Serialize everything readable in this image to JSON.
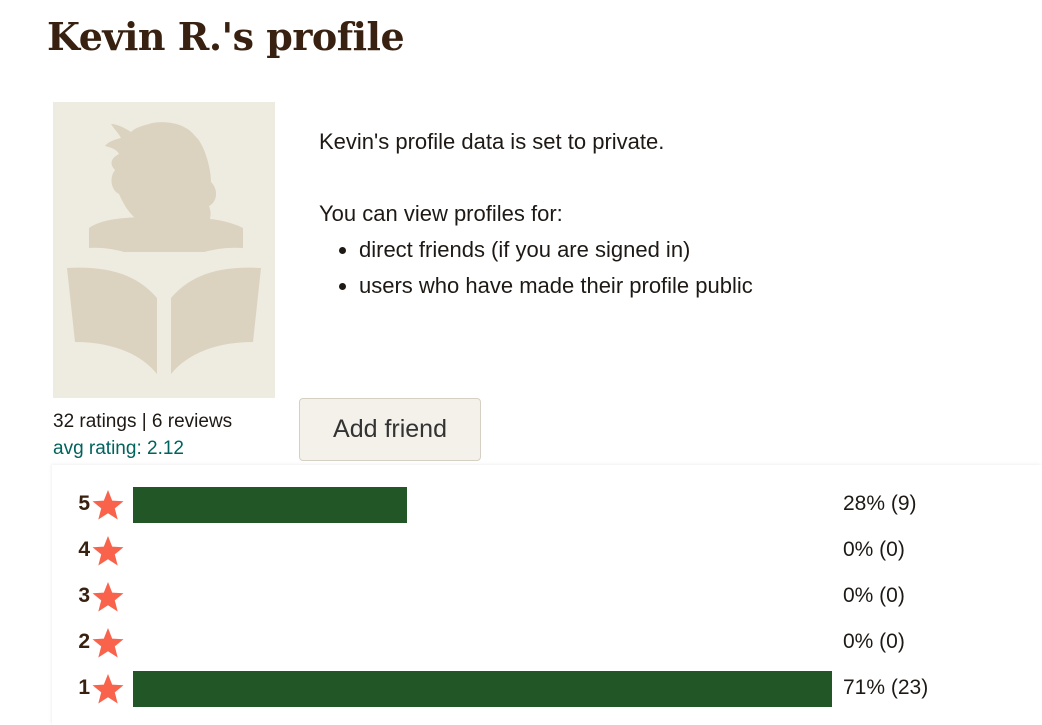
{
  "page": {
    "title": "Kevin R.'s profile"
  },
  "avatar": {
    "icon": "reader-silhouette-icon",
    "colors": {
      "background": "#eeebe0",
      "figure": "#dbd3bf"
    }
  },
  "stats": {
    "counts": "32 ratings | 6 reviews",
    "avg": "avg rating: 2.12",
    "ratings_count": 32,
    "reviews_count": 6,
    "avg_rating": 2.12
  },
  "actions": {
    "add_friend_label": "Add friend"
  },
  "privacy": {
    "message": "Kevin's profile data is set to private.",
    "intro": "You can view profiles for:",
    "items": [
      "direct friends (if you are signed in)",
      "users who have made their profile public"
    ]
  },
  "colors": {
    "bar": "#225626",
    "star": "#f9634b",
    "title": "#382110",
    "avg": "#00635d"
  },
  "chart_data": {
    "type": "bar",
    "orientation": "horizontal",
    "title": "",
    "categories": [
      "5",
      "4",
      "3",
      "2",
      "1"
    ],
    "values": [
      9,
      0,
      0,
      0,
      23
    ],
    "percents": [
      28,
      0,
      0,
      0,
      71
    ],
    "labels": [
      "28% (9)",
      "0% (0)",
      "0% (0)",
      "0% (0)",
      "71% (23)"
    ],
    "xlabel": "",
    "ylabel": "",
    "grid": false,
    "legend": "none"
  }
}
